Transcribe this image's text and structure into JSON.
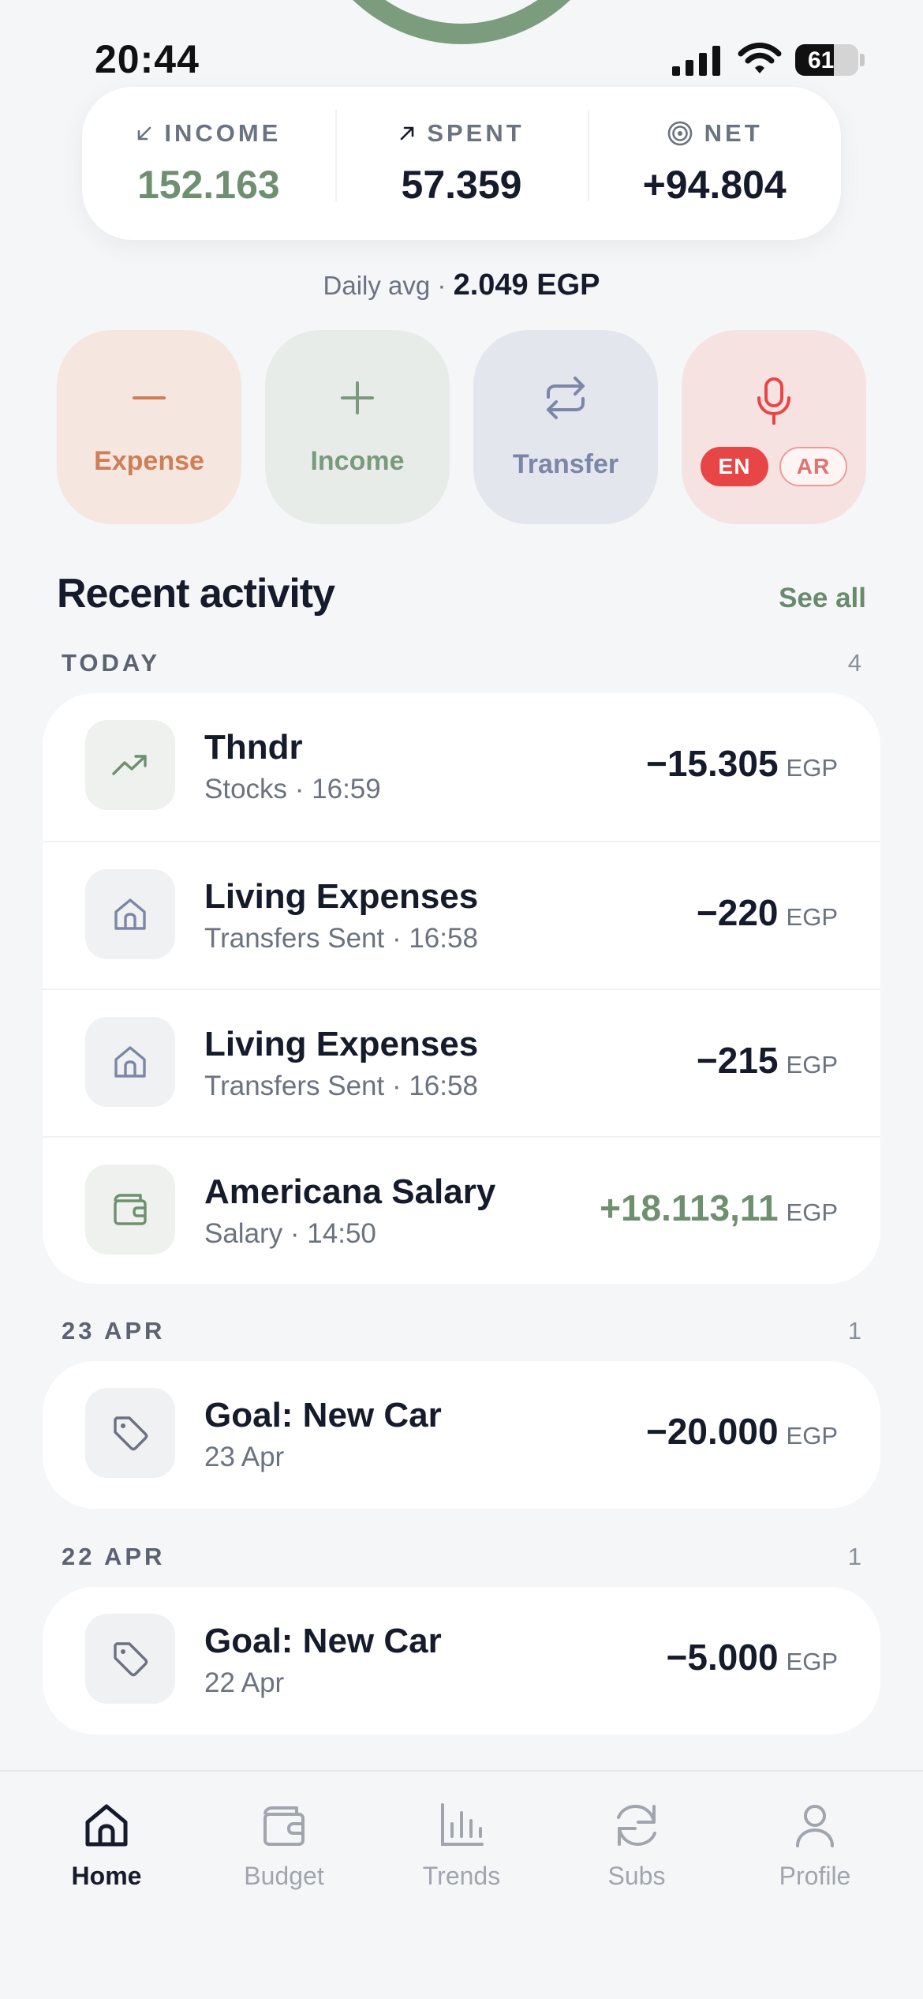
{
  "status_bar": {
    "time": "20:44",
    "battery": "61"
  },
  "summary": {
    "income": {
      "label": "INCOME",
      "value": "152.163",
      "icon": "arrow-down-left-icon"
    },
    "spent": {
      "label": "SPENT",
      "value": "57.359",
      "icon": "arrow-up-right-icon"
    },
    "net": {
      "label": "NET",
      "value": "+94.804",
      "icon": "target-icon"
    }
  },
  "daily": {
    "prefix": "Daily avg · ",
    "value": "2.049 EGP"
  },
  "actions": {
    "expense": "Expense",
    "income": "Income",
    "transfer": "Transfer",
    "lang_en": "EN",
    "lang_ar": "AR"
  },
  "recent": {
    "title": "Recent activity",
    "see_all": "See all",
    "groups": [
      {
        "label": "TODAY",
        "count": "4",
        "items": [
          {
            "name": "Thndr",
            "sub": "Stocks · 16:59",
            "amount": "−15.305",
            "currency": "EGP",
            "icon": "trending-up-icon"
          },
          {
            "name": "Living Expenses",
            "sub": "Transfers Sent · 16:58",
            "amount": "−220",
            "currency": "EGP",
            "icon": "home-icon"
          },
          {
            "name": "Living Expenses",
            "sub": "Transfers Sent · 16:58",
            "amount": "−215",
            "currency": "EGP",
            "icon": "home-icon"
          },
          {
            "name": "Americana Salary",
            "sub": "Salary · 14:50",
            "amount": "+18.113,11",
            "currency": "EGP",
            "icon": "wallet-icon"
          }
        ]
      },
      {
        "label": "23 APR",
        "count": "1",
        "items": [
          {
            "name": "Goal: New Car",
            "sub": "23 Apr",
            "amount": "−20.000",
            "currency": "EGP",
            "icon": "tag-icon"
          }
        ]
      },
      {
        "label": "22 APR",
        "count": "1",
        "items": [
          {
            "name": "Goal: New Car",
            "sub": "22 Apr",
            "amount": "−5.000",
            "currency": "EGP",
            "icon": "tag-icon"
          }
        ]
      }
    ]
  },
  "tabs": [
    {
      "label": "Home",
      "icon": "home-icon",
      "active": true
    },
    {
      "label": "Budget",
      "icon": "wallet-icon",
      "active": false
    },
    {
      "label": "Trends",
      "icon": "bar-chart-icon",
      "active": false
    },
    {
      "label": "Subs",
      "icon": "refresh-icon",
      "active": false
    },
    {
      "label": "Profile",
      "icon": "user-icon",
      "active": false
    }
  ],
  "colors": {
    "accent_green": "#6f8f71",
    "expense": "#cd7f57",
    "transfer": "#7c86a7",
    "voice_red": "#e84646"
  }
}
